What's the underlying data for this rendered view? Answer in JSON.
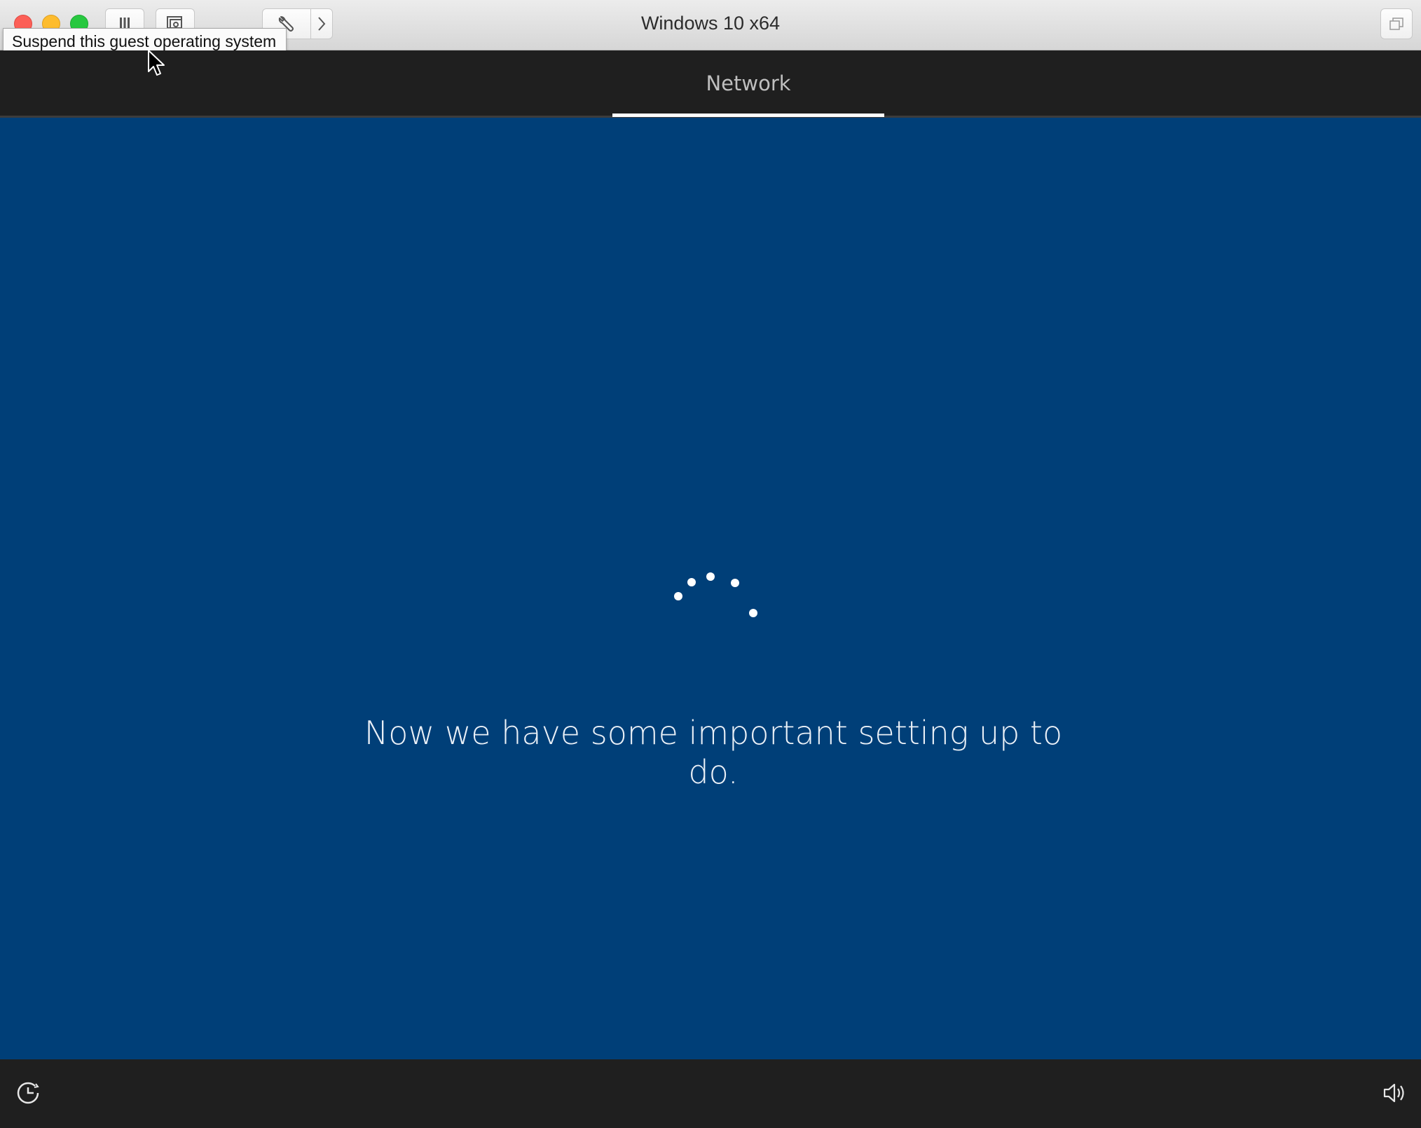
{
  "window": {
    "title": "Windows 10 x64"
  },
  "toolbar": {
    "tooltip": "Suspend this guest operating system",
    "buttons": [
      {
        "name": "suspend",
        "icon": "pause-icon"
      },
      {
        "name": "snapshot",
        "icon": "snapshot-icon"
      },
      {
        "name": "settings",
        "icon": "wrench-icon"
      },
      {
        "name": "forward",
        "icon": "chevron-right-icon"
      },
      {
        "name": "restore",
        "icon": "window-restore-icon"
      }
    ]
  },
  "oobe": {
    "tab_label": "Network",
    "message": "Now we have some important setting up to do.",
    "colors": {
      "background": "#003f78",
      "header": "#1f1f1f",
      "text": "#eaf0f7"
    }
  },
  "bottom_bar": {
    "ease_of_access_icon": "ease-of-access-icon",
    "volume_icon": "volume-icon"
  }
}
